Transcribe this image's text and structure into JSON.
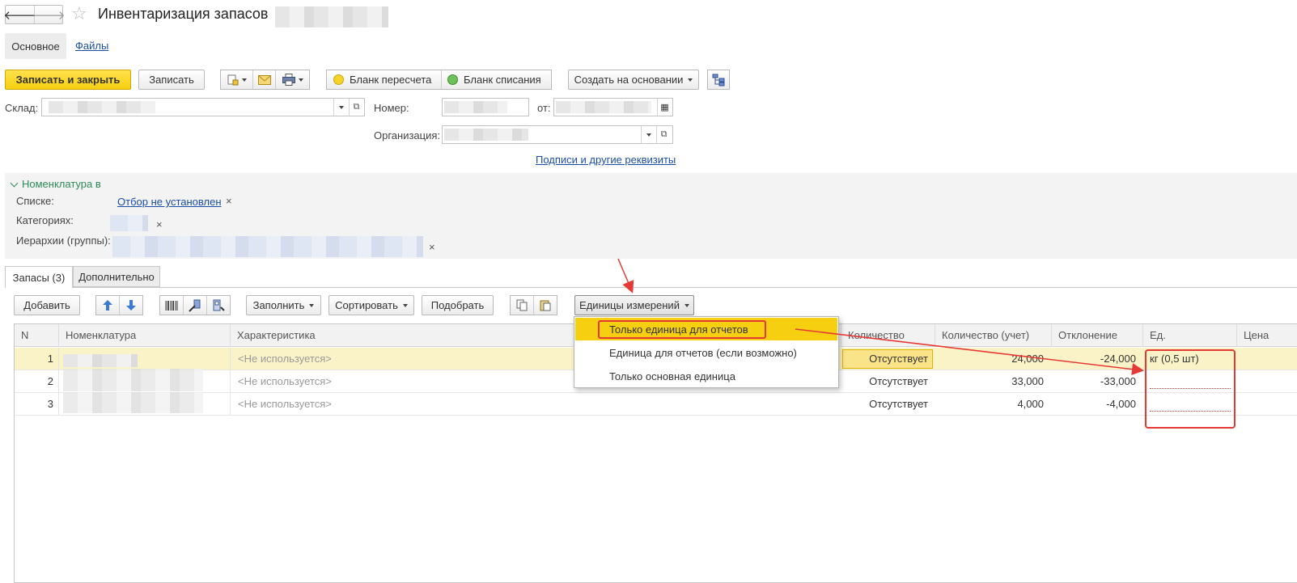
{
  "header": {
    "title": "Инвентаризация запасов"
  },
  "form_tabs": {
    "main": "Основное",
    "files": "Файлы"
  },
  "toolbar": {
    "save_close": "Записать и закрыть",
    "save": "Записать",
    "recount_form": "Бланк пересчета",
    "writeoff_form": "Бланк списания",
    "create_based": "Создать на основании"
  },
  "fields": {
    "warehouse_label": "Склад:",
    "number_label": "Номер:",
    "from_label": "от:",
    "organization_label": "Организация:",
    "signatures_link": "Подписи и другие реквизиты"
  },
  "filter": {
    "title": "Номенклатура в",
    "list_label": "Списке:",
    "list_value": "Отбор не установлен",
    "categories_label": "Категориях:",
    "hierarchy_label": "Иерархии (группы):",
    "clear": "×"
  },
  "tabs": {
    "stock": "Запасы (3)",
    "additional": "Дополнительно"
  },
  "table_toolbar": {
    "add": "Добавить",
    "fill": "Заполнить",
    "sort": "Сортировать",
    "pick": "Подобрать",
    "units": "Единицы измерений"
  },
  "units_menu": {
    "items": [
      "Только единица для отчетов",
      "Единица для отчетов (если возможно)",
      "Только основная единица"
    ]
  },
  "table": {
    "columns": [
      "N",
      "Номенклатура",
      "Характеристика",
      "Количество",
      "Количество (учет)",
      "Отклонение",
      "Ед.",
      "Цена"
    ],
    "rows": [
      {
        "n": "1",
        "characteristic": "<Не используется>",
        "quantity": "Отсутствует",
        "quantity_acc": "24,000",
        "deviation": "-24,000",
        "unit": "кг (0,5 шт)"
      },
      {
        "n": "2",
        "characteristic": "<Не используется>",
        "quantity": "Отсутствует",
        "quantity_acc": "33,000",
        "deviation": "-33,000",
        "unit": ""
      },
      {
        "n": "3",
        "characteristic": "<Не используется>",
        "quantity": "Отсутствует",
        "quantity_acc": "4,000",
        "deviation": "-4,000",
        "unit": ""
      }
    ]
  },
  "colors": {
    "accent_yellow": "#f6cf10",
    "highlight_row": "#fbf3c8",
    "annotation_red": "#e53935",
    "link_blue": "#1a4ea6",
    "filter_green": "#2e8b57"
  }
}
